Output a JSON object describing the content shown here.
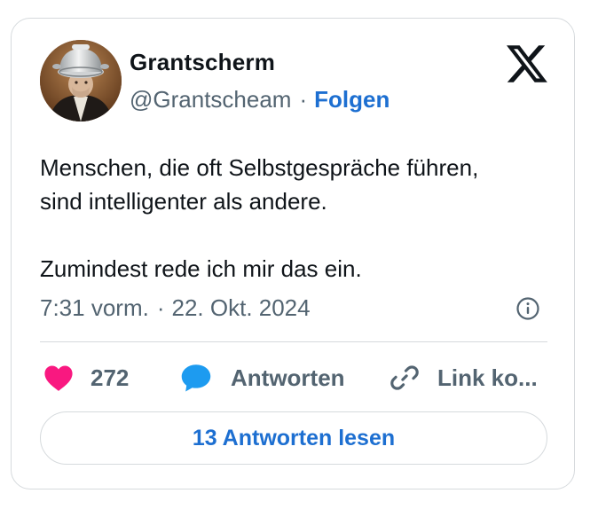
{
  "author": {
    "display_name": "Grantscherm",
    "handle": "@Grantscheam",
    "separator": "·",
    "follow_label": "Folgen"
  },
  "tweet": {
    "text_line_1": "Menschen, die oft Selbstgespräche führen,",
    "text_line_2": "sind intelligenter als andere.",
    "text_line_3": "Zumindest rede ich mir das ein.",
    "time": "7:31 vorm.",
    "separator": "·",
    "date": "22. Okt. 2024"
  },
  "actions": {
    "like_count": "272",
    "reply_label": "Antworten",
    "copy_link_label": "Link ko..."
  },
  "read_replies_label": "13 Antworten lesen",
  "icons": {
    "brand": "x-logo-icon",
    "info": "info-icon",
    "like": "heart-icon",
    "reply": "speech-bubble-icon",
    "link": "link-icon"
  },
  "colors": {
    "accent_blue": "#1d6fd1",
    "heart": "#f91880",
    "reply_bubble": "#1d9bf0",
    "secondary_text": "#536471",
    "border": "#d6dadd"
  }
}
